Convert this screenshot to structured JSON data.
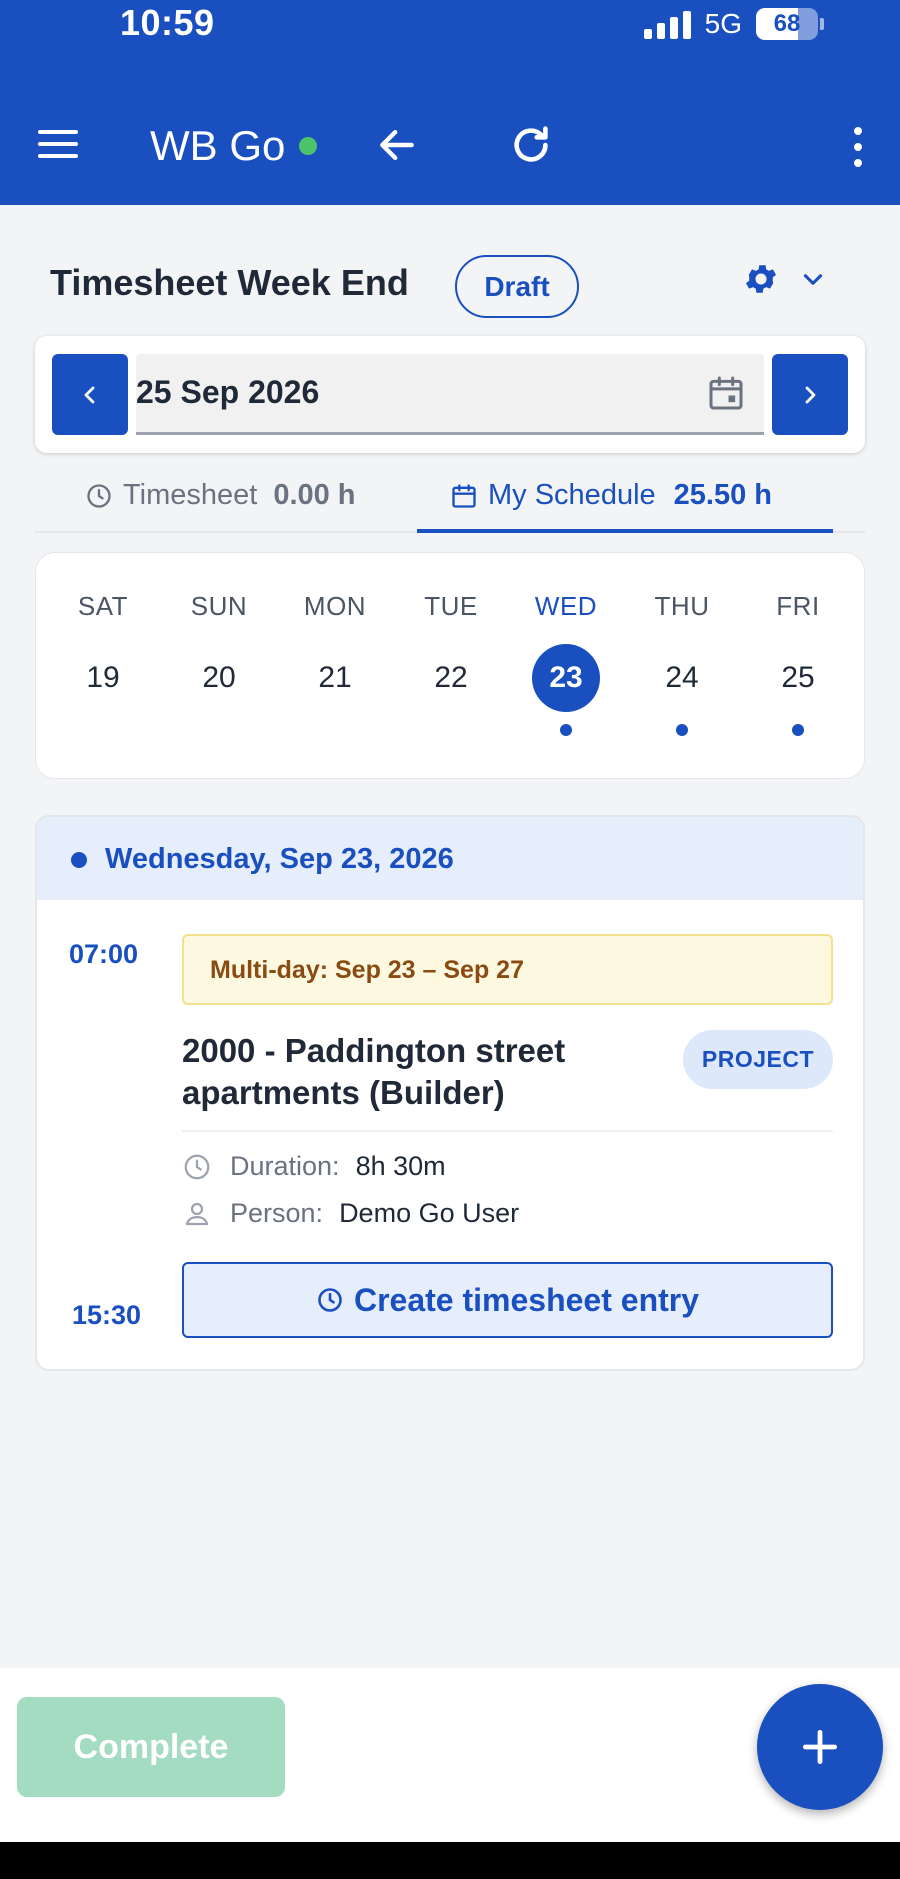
{
  "status_bar": {
    "time": "10:59",
    "network": "5G",
    "battery": "68",
    "battery_level": 0.68
  },
  "app_bar": {
    "title": "WB Go",
    "online": true
  },
  "page": {
    "title": "Timesheet Week End",
    "status_badge": "Draft"
  },
  "date_picker": {
    "value": "25 Sep 2026"
  },
  "tabs": [
    {
      "label": "Timesheet",
      "hours": "0.00 h",
      "active": false
    },
    {
      "label": "My Schedule",
      "hours": "25.50 h",
      "active": true
    }
  ],
  "week": {
    "days": [
      {
        "name": "SAT",
        "num": "19",
        "selected": false,
        "has_event": false
      },
      {
        "name": "SUN",
        "num": "20",
        "selected": false,
        "has_event": false
      },
      {
        "name": "MON",
        "num": "21",
        "selected": false,
        "has_event": false
      },
      {
        "name": "TUE",
        "num": "22",
        "selected": false,
        "has_event": false
      },
      {
        "name": "WED",
        "num": "23",
        "selected": true,
        "has_event": true
      },
      {
        "name": "THU",
        "num": "24",
        "selected": false,
        "has_event": true
      },
      {
        "name": "FRI",
        "num": "25",
        "selected": false,
        "has_event": true
      }
    ]
  },
  "event": {
    "date_header": "Wednesday, Sep 23, 2026",
    "start_time": "07:00",
    "end_time": "15:30",
    "multiday_label": "Multi-day: Sep 23 – Sep 27",
    "title": "2000 - Paddington street apartments (Builder)",
    "badge": "PROJECT",
    "duration_label": "Duration:",
    "duration_value": "8h 30m",
    "person_label": "Person:",
    "person_value": "Demo Go User",
    "action_label": "Create timesheet entry"
  },
  "footer": {
    "complete_label": "Complete"
  },
  "colors": {
    "primary": "#1a4fc0",
    "online": "#4cc36b",
    "complete_disabled": "#a3dcc0",
    "multiday_bg": "#fdf9e1",
    "multiday_text": "#8a4b12"
  }
}
